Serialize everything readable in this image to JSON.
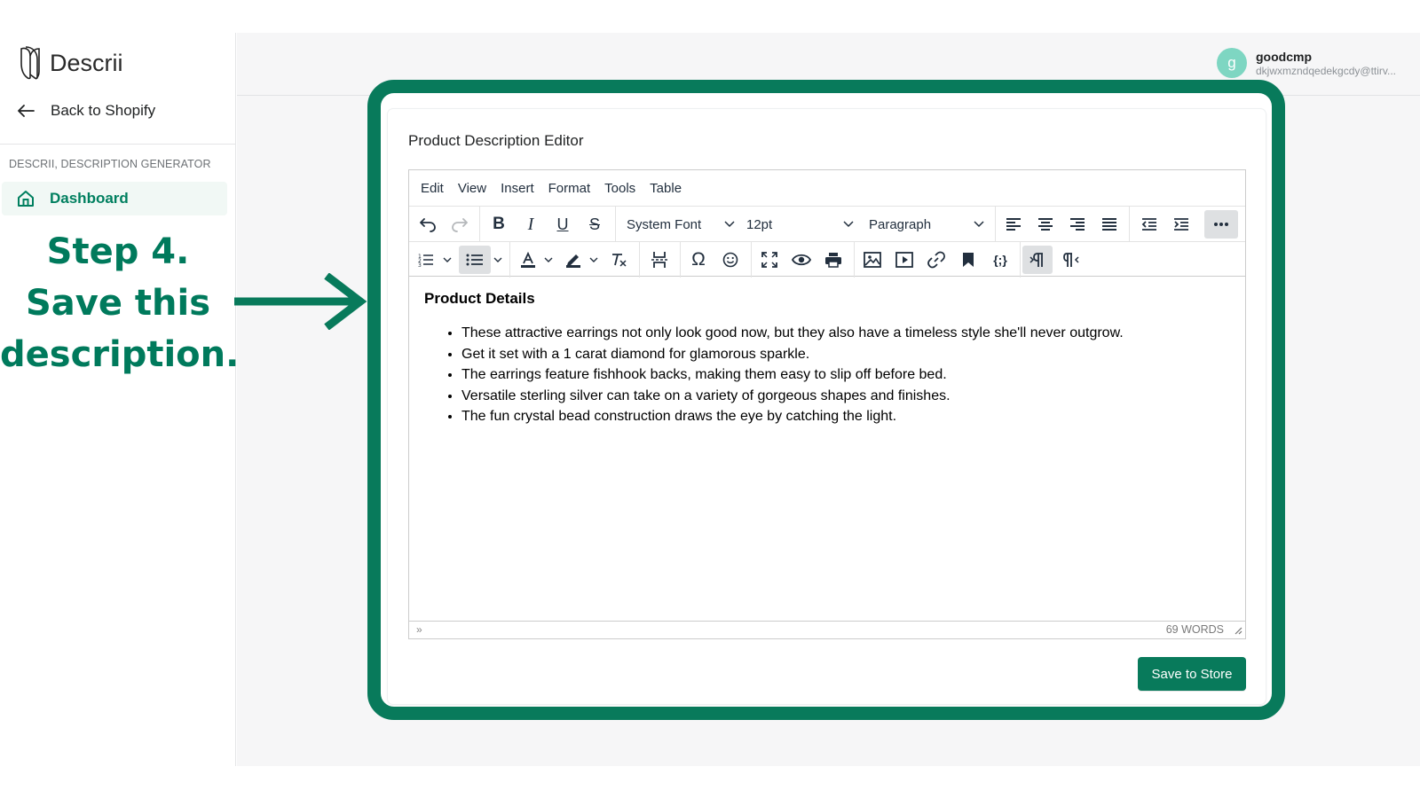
{
  "sidebar": {
    "logo_text": "Descrii",
    "back_label": "Back to Shopify",
    "section_title": "DESCRII, DESCRIPTION GENERATOR",
    "nav": [
      {
        "label": "Dashboard",
        "icon": "home-icon"
      }
    ]
  },
  "annotation": {
    "line1": "Step 4.",
    "line2": "Save this",
    "line3": "description."
  },
  "user": {
    "initial": "g",
    "name": "goodcmp",
    "email": "dkjwxmzndqedekgcdy@ttirv..."
  },
  "card": {
    "title": "Product Description Editor"
  },
  "editor": {
    "menu": [
      "Edit",
      "View",
      "Insert",
      "Format",
      "Tools",
      "Table"
    ],
    "font_family": "System Font",
    "font_size": "12pt",
    "block_format": "Paragraph",
    "content": {
      "heading": "Product Details",
      "bullets": [
        "These attractive earrings not only look good now, but they also have a timeless style she'll never outgrow.",
        "Get it set with a 1 carat diamond for glamorous sparkle.",
        "The earrings feature fishhook backs, making them easy to slip off before bed.",
        "Versatile sterling silver can take on a variety of gorgeous shapes and finishes.",
        "The fun crystal bead construction draws the eye by catching the light."
      ]
    },
    "status_path": "»",
    "word_count": "69 WORDS"
  },
  "save_button": "Save to Store",
  "colors": {
    "brand_green": "#087a5b",
    "nav_active_bg": "#f1f8f5",
    "avatar_bg": "#7ed6c2"
  }
}
